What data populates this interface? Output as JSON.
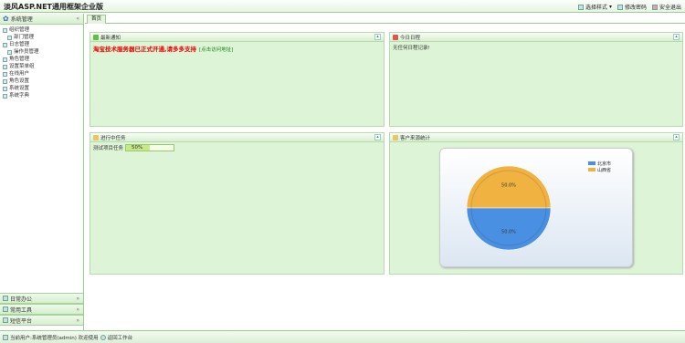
{
  "app": {
    "title": "淡风ASP.NET通用框架企业版"
  },
  "toplinks": [
    {
      "label": "选择样式",
      "icon": "style-icon"
    },
    {
      "label": "修改密码",
      "icon": "key-icon"
    },
    {
      "label": "安全退出",
      "icon": "exit-icon"
    }
  ],
  "sidebar": {
    "header": "系统管理",
    "items": [
      {
        "label": "组织管理",
        "level": 1
      },
      {
        "label": "部门管理",
        "level": 2
      },
      {
        "label": "日志管理",
        "level": 1
      },
      {
        "label": "操作员管理",
        "level": 2
      },
      {
        "label": "角色管理",
        "level": 1
      },
      {
        "label": "设置菜单组",
        "level": 1
      },
      {
        "label": "在线用户",
        "level": 1
      },
      {
        "label": "角色设置",
        "level": 1
      },
      {
        "label": "系统设置",
        "level": 1
      },
      {
        "label": "系统字典",
        "level": 1
      }
    ],
    "bottom": [
      "日常办公",
      "常用工具",
      "短信平台"
    ]
  },
  "tabs": [
    {
      "label": "首页"
    }
  ],
  "panels": {
    "notice": {
      "title": "最新通知",
      "text": "淘宝技术服务器已正式开通,请多多支持",
      "link": "[点击访问地址]"
    },
    "log": {
      "title": "今日日程",
      "text": "无任何日程记录!"
    },
    "tasks": {
      "title": "进行中任务",
      "item": "测试项目任务",
      "progress_label": "50%",
      "progress": 0.5
    },
    "chart": {
      "title": "客户来源统计"
    }
  },
  "chart_data": {
    "type": "pie",
    "series": [
      {
        "name": "北京市",
        "value": 50,
        "label": "50.0%",
        "color": "#4a90e2"
      },
      {
        "name": "山西省",
        "value": 50,
        "label": "50.0%",
        "color": "#f0b240"
      }
    ]
  },
  "footer": {
    "text": "当前用户:系统管理员(admin) 欢迎使用",
    "link": "返回工作台"
  }
}
